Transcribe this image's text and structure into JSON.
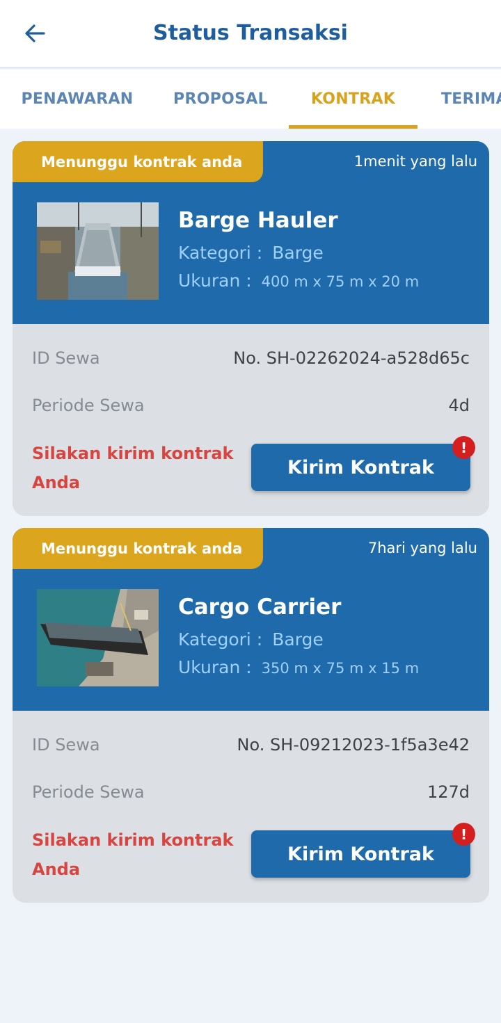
{
  "header": {
    "title": "Status Transaksi",
    "back_icon": "arrow-left-icon"
  },
  "tabs": [
    {
      "label": "PENAWARAN",
      "active": false
    },
    {
      "label": "PROPOSAL",
      "active": false
    },
    {
      "label": "KONTRAK",
      "active": true
    },
    {
      "label": "TERIMA",
      "active": false
    }
  ],
  "colors": {
    "primary": "#1f6aab",
    "accent": "#dca51e",
    "warning": "#d64540",
    "alert": "#d51f1f"
  },
  "cards": [
    {
      "status": "Menunggu kontrak anda",
      "time_ago": "1menit yang lalu",
      "name": "Barge Hauler",
      "category_label": "Kategori :",
      "category": "Barge",
      "size_label": "Ukuran :",
      "size": "400 m x 75 m x 20 m",
      "id_label": "ID Sewa",
      "id_value": "No. SH-02262024-a528d65c",
      "period_label": "Periode Sewa",
      "period_value": "4d",
      "warning": "Silakan kirim kontrak Anda",
      "button_label": "Kirim Kontrak",
      "alert_mark": "!"
    },
    {
      "status": "Menunggu kontrak anda",
      "time_ago": "7hari yang lalu",
      "name": "Cargo Carrier",
      "category_label": "Kategori :",
      "category": "Barge",
      "size_label": "Ukuran :",
      "size": "350 m x 75 m x 15 m",
      "id_label": "ID Sewa",
      "id_value": "No. SH-09212023-1f5a3e42",
      "period_label": "Periode Sewa",
      "period_value": "127d",
      "warning": "Silakan kirim kontrak Anda",
      "button_label": "Kirim Kontrak",
      "alert_mark": "!"
    }
  ]
}
